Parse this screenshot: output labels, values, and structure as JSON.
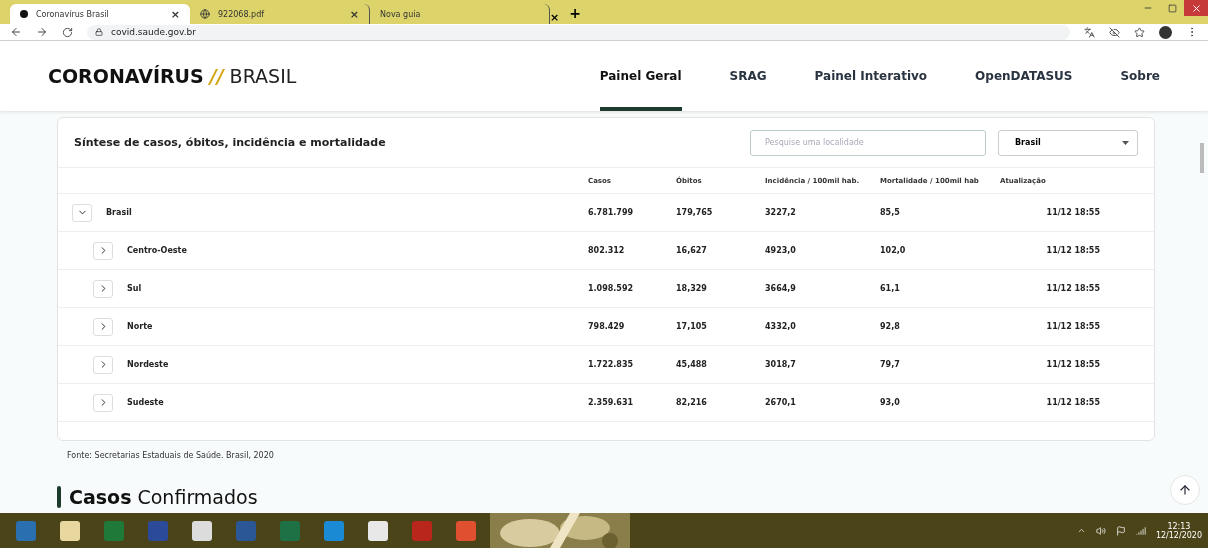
{
  "browser": {
    "tabs": [
      {
        "title": "Coronavírus Brasil",
        "selected": true,
        "kind": "dot"
      },
      {
        "title": "922068.pdf",
        "selected": false,
        "kind": "globe"
      },
      {
        "title": "Nova guia",
        "selected": false,
        "kind": "none"
      }
    ],
    "new_tab": "+",
    "close": "×",
    "url": "covid.saude.gov.br"
  },
  "header": {
    "logo_bold": "CORONAVÍRUS",
    "logo_slash": "//",
    "logo_light": "BRASIL",
    "nav": [
      {
        "label": "Painel Geral",
        "selected": true
      },
      {
        "label": "SRAG",
        "selected": false
      },
      {
        "label": "Painel Interativo",
        "selected": false
      },
      {
        "label": "OpenDATASUS",
        "selected": false
      },
      {
        "label": "Sobre",
        "selected": false
      }
    ]
  },
  "card": {
    "title": "Síntese de casos, óbitos, incidência e mortalidade",
    "search": {
      "placeholder": "Pesquise uma localidade"
    },
    "select": {
      "value": "Brasil"
    },
    "columns": [
      "Casos",
      "Óbitos",
      "Incidência / 100mil hab.",
      "Mortalidade / 100mil hab",
      "Atualização"
    ],
    "rows": [
      {
        "name": "Brasil",
        "expanded": true,
        "cells": [
          "6.781.799",
          "179,765",
          "3227,2",
          "85,5",
          "11/12 18:55"
        ],
        "children": [
          {
            "name": "Centro-Oeste",
            "expanded": false,
            "cells": [
              "802.312",
              "16,627",
              "4923,0",
              "102,0",
              "11/12 18:55"
            ]
          },
          {
            "name": "Sul",
            "expanded": false,
            "cells": [
              "1.098.592",
              "18,329",
              "3664,9",
              "61,1",
              "11/12 18:55"
            ]
          },
          {
            "name": "Norte",
            "expanded": false,
            "cells": [
              "798.429",
              "17,105",
              "4332,0",
              "92,8",
              "11/12 18:55"
            ]
          },
          {
            "name": "Nordeste",
            "expanded": false,
            "cells": [
              "1.722.835",
              "45,488",
              "3018,7",
              "79,7",
              "11/12 18:55"
            ]
          },
          {
            "name": "Sudeste",
            "expanded": false,
            "cells": [
              "2.359.631",
              "82,216",
              "2670,1",
              "93,0",
              "11/12 18:55"
            ]
          }
        ]
      }
    ]
  },
  "source": "Fonte: Secretarias Estaduais de Saúde. Brasil, 2020",
  "section_title": "**Casos** Confirmados",
  "taskbar": {
    "time": "12:13",
    "date": "12/12/2020"
  }
}
